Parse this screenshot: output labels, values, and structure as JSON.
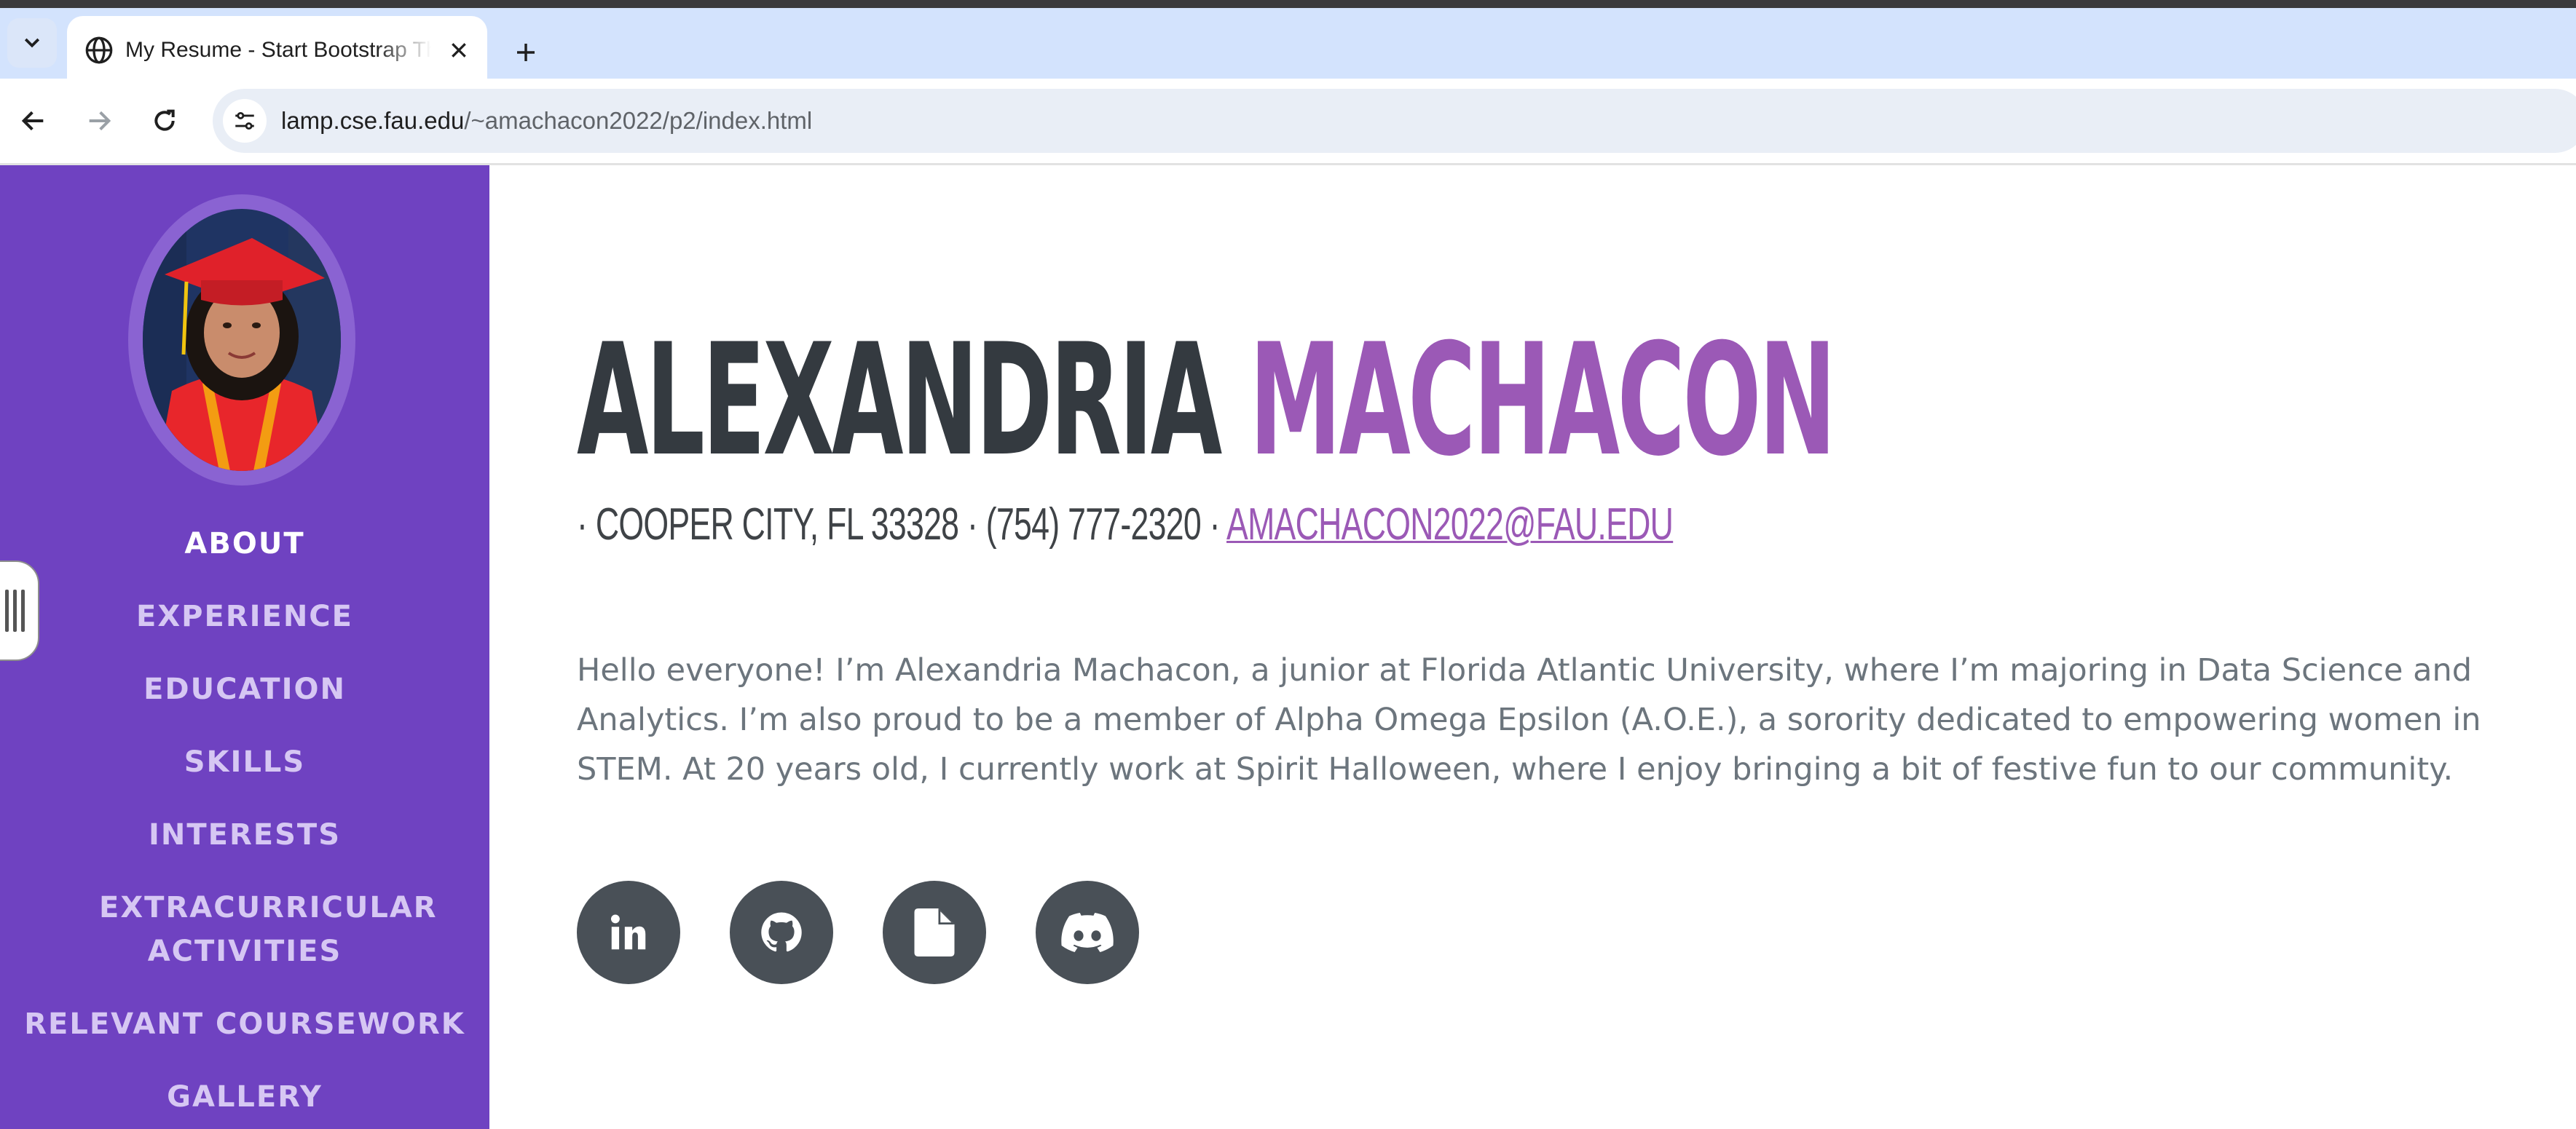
{
  "browser": {
    "tab_title": "My Resume - Start Bootstrap Theme",
    "url_host": "lamp.cse.fau.edu",
    "url_path": "/~amachacon2022/p2/index.html"
  },
  "sidebar": {
    "nav_items": [
      {
        "label": "ABOUT",
        "active": true
      },
      {
        "label": "EXPERIENCE",
        "active": false
      },
      {
        "label": "EDUCATION",
        "active": false
      },
      {
        "label": "SKILLS",
        "active": false
      },
      {
        "label": "INTERESTS",
        "active": false
      },
      {
        "label": "EXTRACURRICULAR ACTIVITIES",
        "active": false
      },
      {
        "label": "RELEVANT COURSEWORK",
        "active": false
      },
      {
        "label": "GALLERY",
        "active": false
      }
    ]
  },
  "about": {
    "first_name": "ALEXANDRIA",
    "last_name": "MACHACON",
    "address": "· COOPER CITY, FL 33328 · (754) 777-2320 ·",
    "email": "AMACHACON2022@FAU.EDU",
    "bio": "Hello everyone! I’m Alexandria Machacon, a junior at Florida Atlantic University, where I’m majoring in Data Science and Analytics. I’m also proud to be a member of Alpha Omega Epsilon (A.O.E.), a sorority dedicated to empowering women in STEM. At 20 years old, I currently work at Spirit Halloween, where I enjoy bringing a bit of festive fun to our community.",
    "social_icons": [
      "linkedin-icon",
      "github-icon",
      "file-icon",
      "discord-icon"
    ]
  },
  "colors": {
    "sidebar": "#6f42c1",
    "accent": "#9b59b6",
    "heading": "#343a40",
    "social_bg": "#495057"
  }
}
